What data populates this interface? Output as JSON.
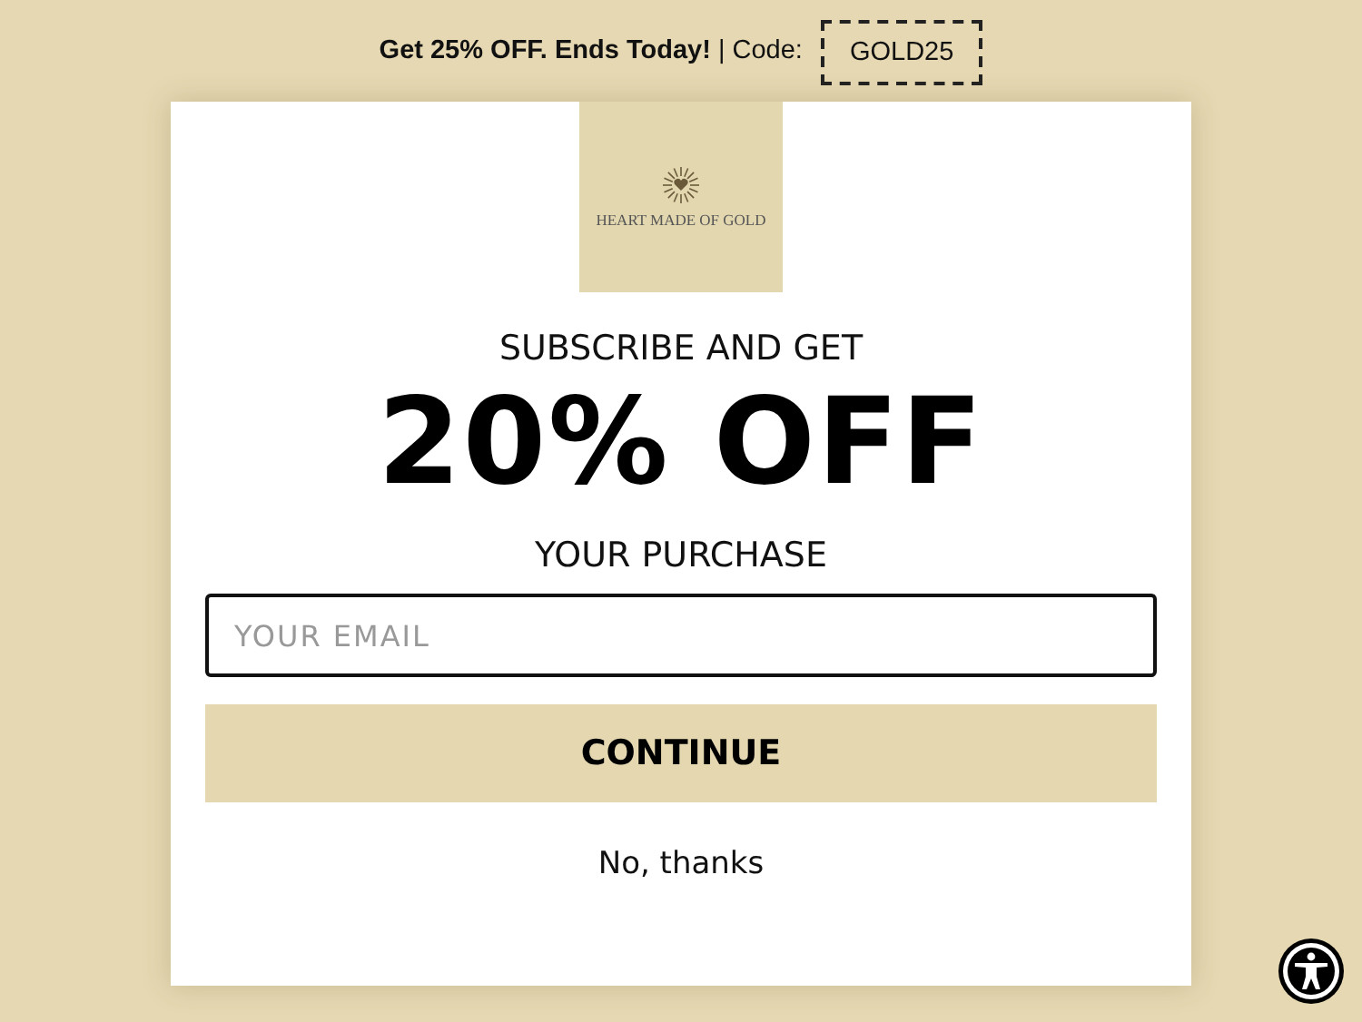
{
  "announcement": {
    "text": "**Get 25% OFF. Ends Today!** | Code:",
    "code": "GOLD25"
  },
  "popup": {
    "logo_text": "HEART MADE OF GOLD",
    "heading_top": "SUBSCRIBE AND GET",
    "heading_main": "20% OFF",
    "heading_bottom": "YOUR PURCHASE",
    "email": {
      "placeholder": "YOUR EMAIL"
    },
    "submit": "CONTINUE",
    "decline": "No, thanks"
  },
  "accessibility_button": {
    "kind": "accessibility"
  }
}
